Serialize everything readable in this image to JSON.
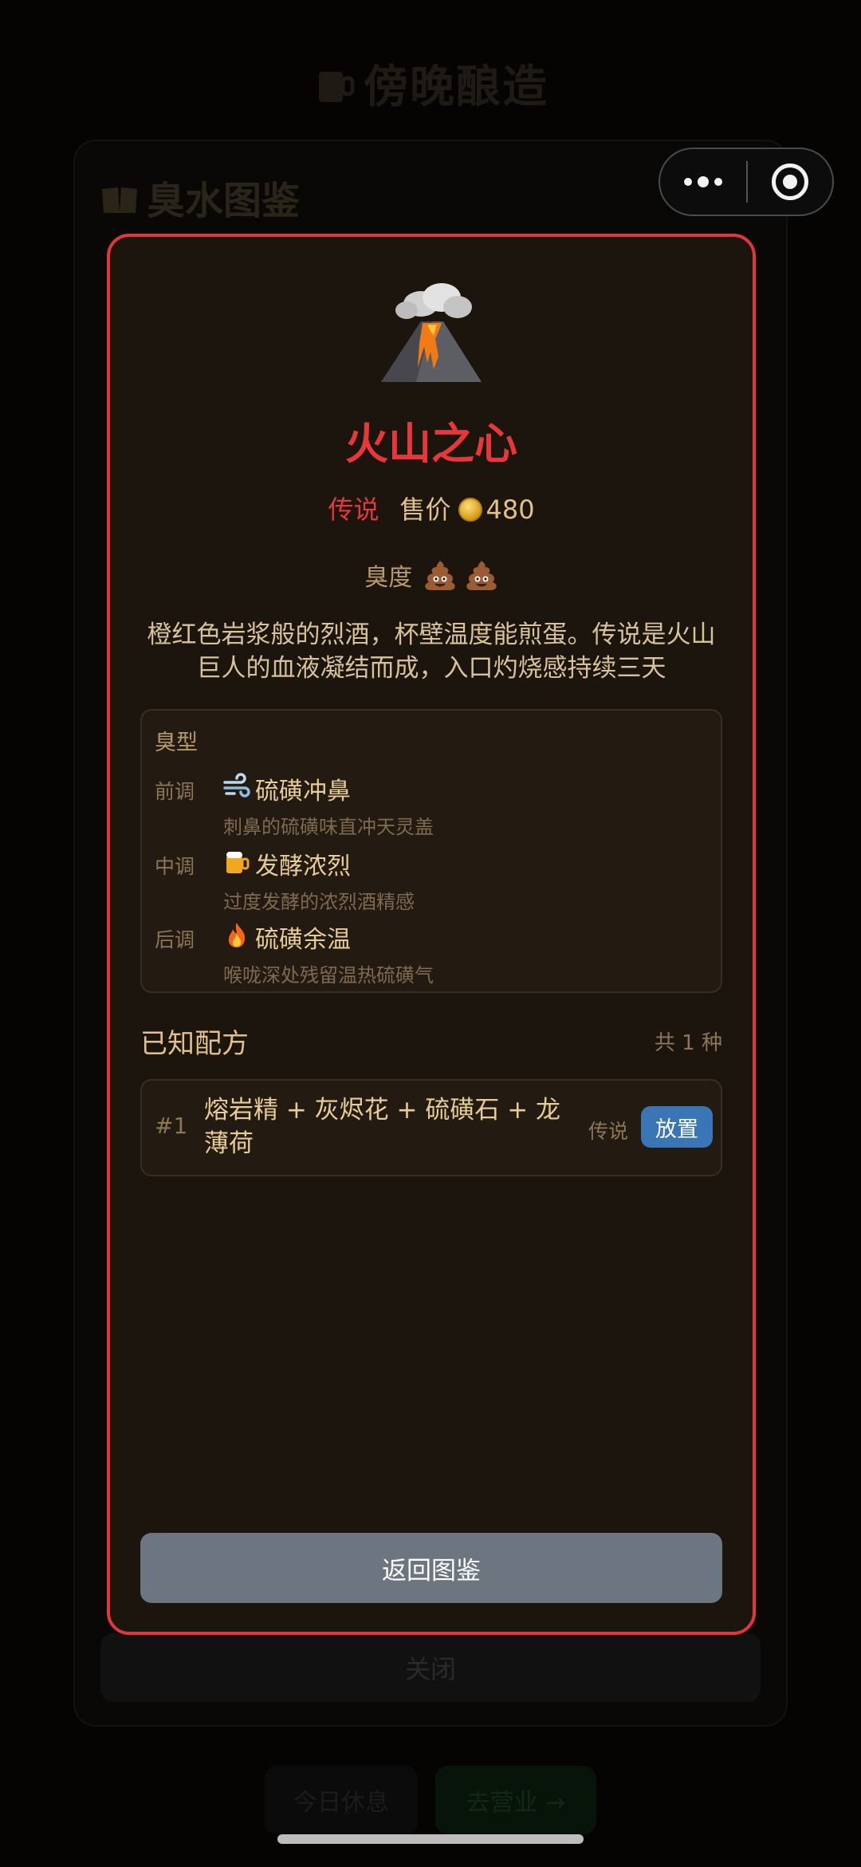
{
  "background": {
    "app_title": "傍晚酿造",
    "modal_title": "臭水图鉴",
    "close_label": "关闭",
    "rest_label": "今日休息",
    "go_label": "去营业 →"
  },
  "capsule": {
    "more_icon": "more-dots-icon",
    "close_icon": "record-target-icon"
  },
  "detail": {
    "hero_icon": "volcano-icon",
    "title": "火山之心",
    "rarity": "传说",
    "price_label": "售价",
    "price_value": "480",
    "smell_label": "臭度",
    "smell_level": 2,
    "description": "橙红色岩浆般的烈酒，杯壁温度能煎蛋。传说是火山巨人的血液凝结而成，入口灼烧感持续三天",
    "notes_title": "臭型",
    "notes": [
      {
        "label": "前调",
        "icon": "wind-icon",
        "name": "硫磺冲鼻",
        "detail": "刺鼻的硫磺味直冲天灵盖"
      },
      {
        "label": "中调",
        "icon": "beer-mug-icon",
        "name": "发酵浓烈",
        "detail": "过度发酵的浓烈酒精感"
      },
      {
        "label": "后调",
        "icon": "fire-icon",
        "name": "硫磺余温",
        "detail": "喉咙深处残留温热硫磺气"
      }
    ],
    "recipes_title": "已知配方",
    "recipes_count": "共 1 种",
    "recipes": [
      {
        "no": "#1",
        "text": "熔岩精 + 灰烬花 + 硫磺石 + 龙薄荷",
        "tag": "传说",
        "button": "放置"
      }
    ],
    "back_label": "返回图鉴"
  },
  "colors": {
    "accent_red": "#e5383b",
    "gold": "#e1c089",
    "button_blue": "#3a76b6",
    "button_grey": "#6c7580"
  }
}
